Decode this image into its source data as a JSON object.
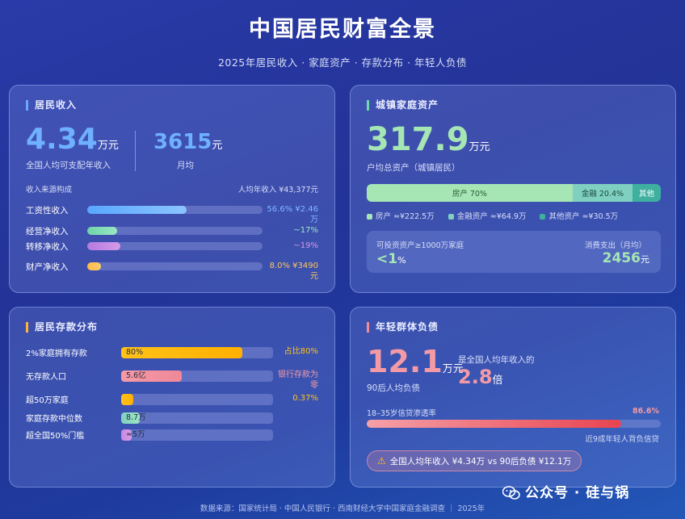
{
  "header": {
    "title": "中国居民财富全景",
    "subtitle": "2025年居民收入 · 家庭资产 · 存款分布 · 年轻人负债"
  },
  "colors": {
    "income_blue": "#6fb0ff",
    "asset_green": "#9fe0b0",
    "deposit_gold": "#ffc21a",
    "debt_pink": "#f39aa6"
  },
  "income": {
    "title": "居民收入",
    "big_value": "4.34",
    "big_unit": "万元",
    "big_label": "全国人均可支配年收入",
    "monthly_value": "3615",
    "monthly_unit": "元",
    "monthly_label": "月均",
    "source_label": "收入来源构成",
    "annual_label": "人均年收入 ¥43,377元"
  },
  "assets": {
    "title": "城镇家庭资产",
    "big_value": "317.9",
    "big_unit": "万元",
    "big_label": "户均总资产（城镇居民）",
    "legend": [
      "房产 ≈¥222.5万",
      "金融资产 ≈¥64.9万",
      "其他资产 ≈¥30.5万"
    ],
    "invest_label": "可投资资产≥1000万家庭",
    "invest_value": "<1",
    "invest_unit": "%",
    "spend_label": "消费支出（月均）",
    "spend_value": "2456",
    "spend_unit": "元"
  },
  "deposits": {
    "title": "居民存款分布"
  },
  "debt": {
    "title": "年轻群体负债",
    "big_value": "12.1",
    "big_unit": "万元",
    "big_label": "90后人均负债",
    "ratio_label": "是全国人均年收入的",
    "ratio_value": "2.8",
    "ratio_unit": "倍",
    "penetration_label": "18–35岁信贷渗透率",
    "penetration_value": "86.6%",
    "penetration_note": "近9成年轻人背负信贷",
    "warning": "全国人均年收入 ¥4.34万 vs 90后负债 ¥12.1万"
  },
  "chart_data": [
    {
      "type": "bar",
      "title": "收入来源构成",
      "categories": [
        "工资性收入",
        "经营净收入",
        "转移净收入",
        "财产净收入"
      ],
      "values": [
        56.6,
        17,
        19,
        8.0
      ],
      "value_labels": [
        "56.6% ¥2.46万",
        "~17%",
        "~19%",
        "8.0% ¥3490元"
      ],
      "xlim": [
        0,
        100
      ]
    },
    {
      "type": "bar",
      "title": "户均总资产构成",
      "categories": [
        "房产",
        "金融",
        "其他"
      ],
      "values": [
        70,
        20.4,
        9.6
      ],
      "value_labels": [
        "房产 70%",
        "金融 20.4%",
        "其他"
      ],
      "xlim": [
        0,
        100
      ]
    },
    {
      "type": "bar",
      "title": "居民存款分布",
      "categories": [
        "2%家庭拥有存款",
        "无存款人口",
        "超50万家庭",
        "家庭存款中位数",
        "超全国50%门槛"
      ],
      "values": [
        80,
        40,
        8,
        12,
        7
      ],
      "bar_labels": [
        "80%",
        "5.6亿",
        "",
        "8.7万",
        "≈5万"
      ],
      "value_labels": [
        "占比80%",
        "银行存款为零",
        "0.37%",
        "",
        ""
      ],
      "xlim": [
        0,
        100
      ]
    },
    {
      "type": "bar",
      "title": "18–35岁信贷渗透率",
      "categories": [
        "18–35岁信贷渗透率"
      ],
      "values": [
        86.6
      ],
      "xlim": [
        0,
        100
      ]
    }
  ],
  "footer": "数据来源：国家统计局 · 中国人民银行 · 西南财经大学中国家庭金融调查 ｜ 2025年",
  "watermark": "公众号 · 硅与锅"
}
